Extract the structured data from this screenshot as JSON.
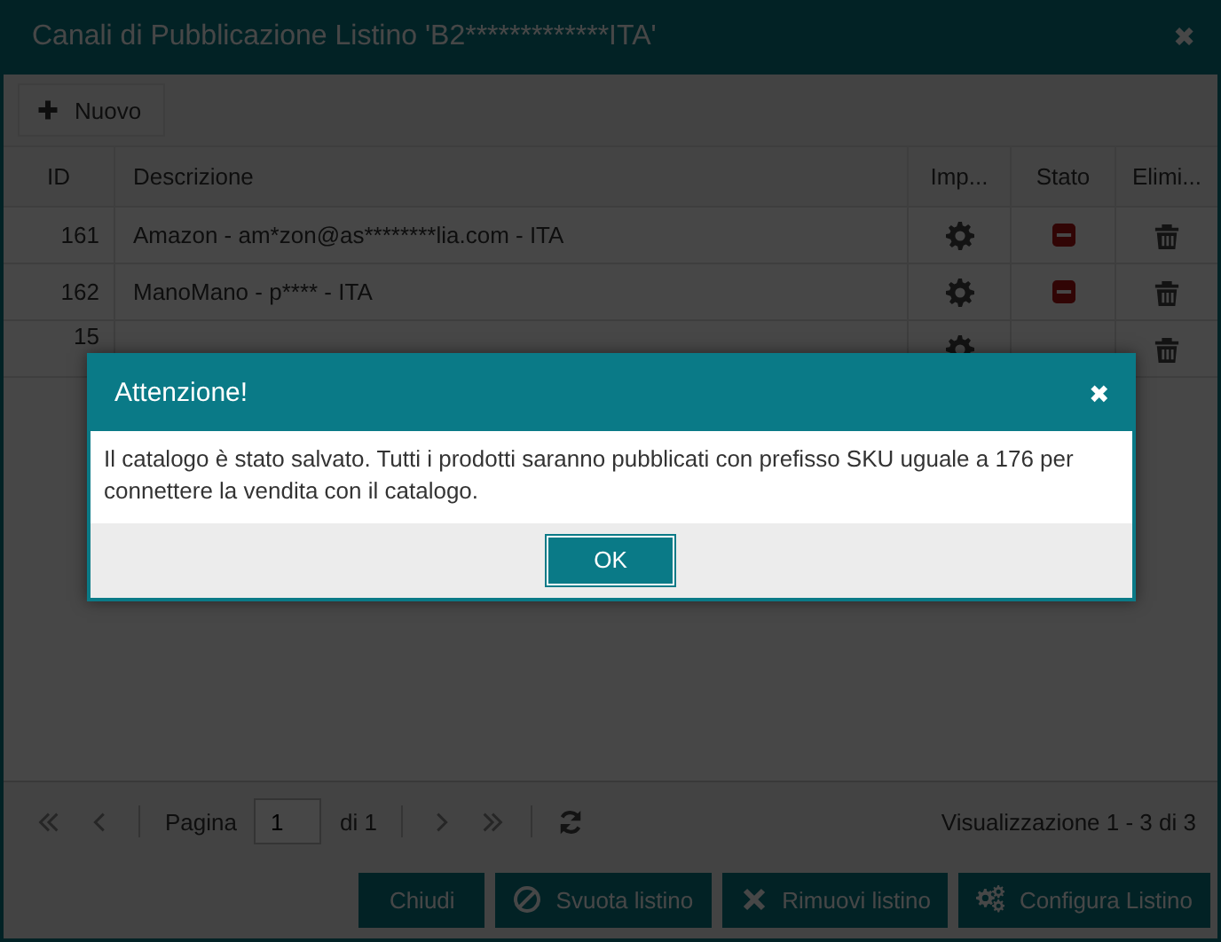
{
  "window": {
    "title": "Canali di Pubblicazione Listino 'B2*************ITA'",
    "close": "✖"
  },
  "toolbar": {
    "new_button": "Nuovo"
  },
  "table": {
    "columns": [
      "ID",
      "Descrizione",
      "Imp...",
      "Stato",
      "Elimi..."
    ],
    "rows": [
      {
        "id": "161",
        "description": "Amazon - am*zon@as********lia.com - ITA",
        "active": false
      },
      {
        "id": "162",
        "description": "ManoMano - p**** - ITA",
        "active": false
      },
      {
        "id": "15"
      }
    ]
  },
  "pager": {
    "page_label": "Pagina",
    "page": "1",
    "of": "di 1",
    "summary": "Visualizzazione 1 - 3 di 3"
  },
  "footer_buttons": [
    {
      "kind": "close",
      "label": "Chiudi"
    },
    {
      "kind": "empty",
      "label": "Svuota listino"
    },
    {
      "kind": "remove",
      "label": "Rimuovi listino"
    },
    {
      "kind": "configure",
      "label": "Configura Listino"
    }
  ],
  "alert": {
    "title": "Attenzione!",
    "close": "✖",
    "message": "Il catalogo è stato salvato. Tutti i prodotti saranno pubblicati con prefisso SKU uguale a 176 per connettere la vendita con il catalogo.",
    "ok": "OK"
  }
}
